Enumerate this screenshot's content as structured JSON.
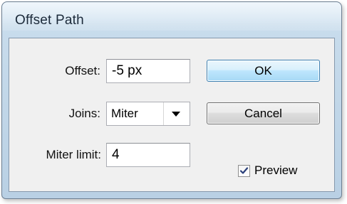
{
  "window": {
    "title": "Offset Path"
  },
  "form": {
    "offset": {
      "label": "Offset:",
      "value": "-5 px"
    },
    "joins": {
      "label": "Joins:",
      "value": "Miter"
    },
    "miter_limit": {
      "label": "Miter limit:",
      "value": "4"
    }
  },
  "buttons": {
    "ok": "OK",
    "cancel": "Cancel"
  },
  "preview": {
    "label": "Preview",
    "checked": true
  }
}
